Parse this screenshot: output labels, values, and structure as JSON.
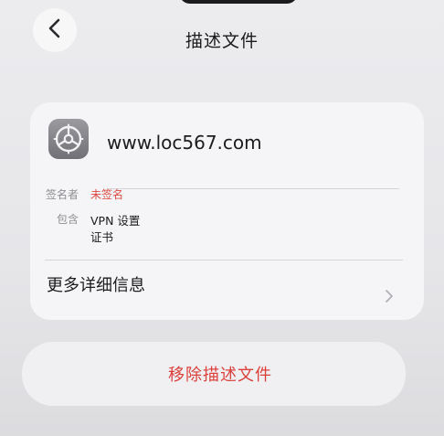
{
  "header": {
    "title": "描述文件",
    "back_icon": "chevron-left-icon"
  },
  "profile": {
    "icon": "gear-icon",
    "name": "www.loc567.com",
    "signer_label": "签名者",
    "signer_value": "未签名",
    "contains_label": "包含",
    "contains_line1": "VPN 设置",
    "contains_line2": "证书",
    "more_info_label": "更多详细信息",
    "more_info_chevron": "chevron-right-icon"
  },
  "actions": {
    "remove_label": "移除描述文件"
  },
  "colors": {
    "accent_red": "#e04a44",
    "card_bg": "#f5f5f7",
    "icon_gray": "#8e8e93"
  }
}
